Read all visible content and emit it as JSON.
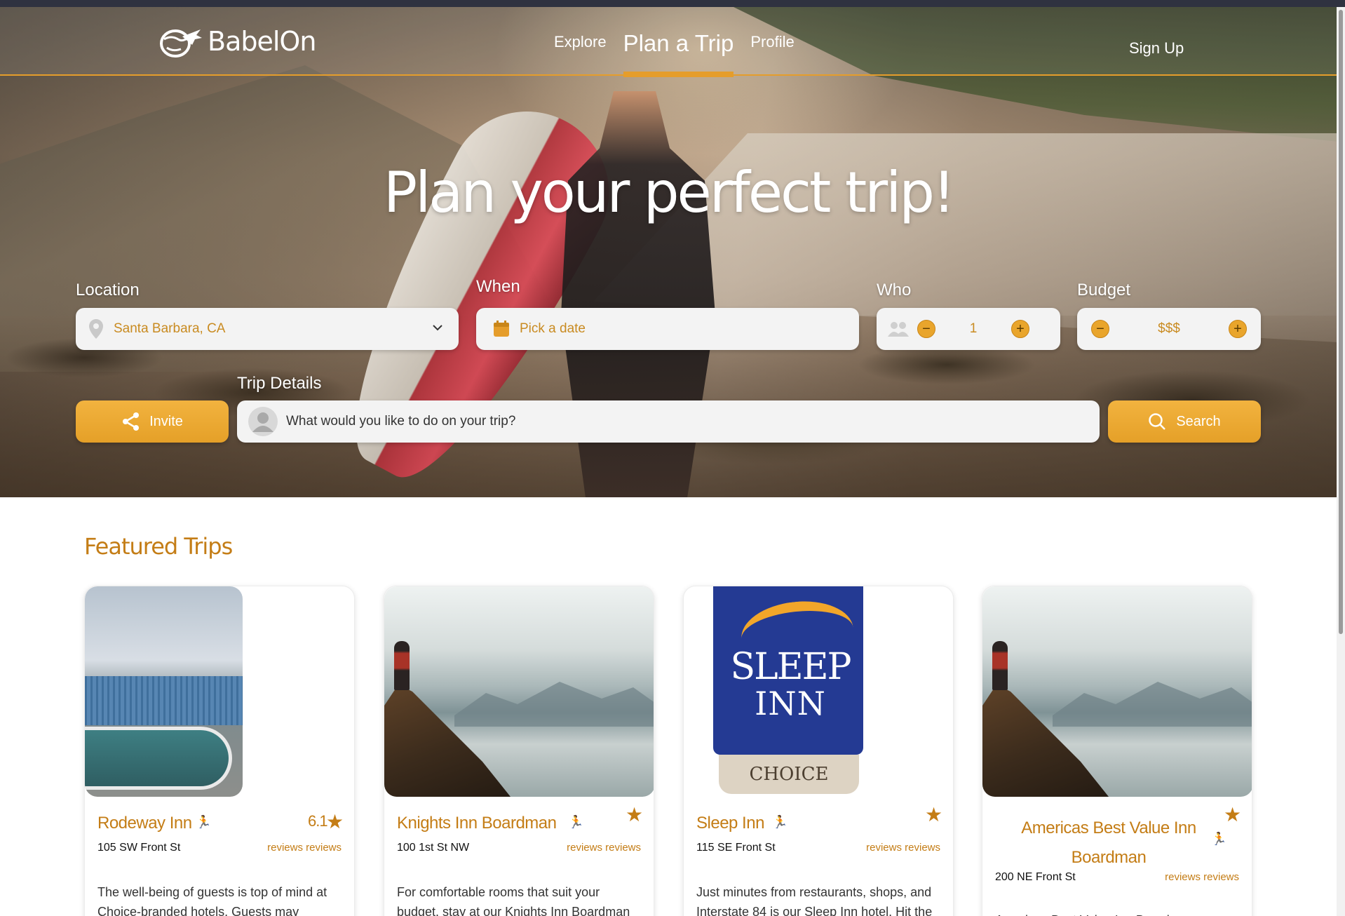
{
  "brand": {
    "name": "BabelOn",
    "accent": "#e59d2b",
    "title_color": "#c47d16"
  },
  "nav": {
    "links": [
      "Explore",
      "Plan a Trip",
      "Profile"
    ],
    "active": "Plan a Trip",
    "sign_up": "Sign Up"
  },
  "hero": {
    "title": "Plan your perfect trip!"
  },
  "search": {
    "location": {
      "label": "Location",
      "value": "Santa Barbara, CA",
      "icon": "map-pin-icon"
    },
    "when": {
      "label": "When",
      "placeholder": "Pick a date",
      "icon": "calendar-icon"
    },
    "who": {
      "label": "Who",
      "value": "1",
      "icon": "people-icon"
    },
    "budget": {
      "label": "Budget",
      "value": "$$$"
    },
    "trip_details": {
      "label": "Trip Details",
      "placeholder": "What would you like to do on your trip?"
    },
    "invite_label": "Invite",
    "search_label": "Search"
  },
  "featured": {
    "title": "Featured Trips",
    "cards": [
      {
        "name": "Rodeway Inn",
        "address": "105 SW Front St",
        "rating": "6.1",
        "reviews": "reviews reviews",
        "description": "The well-being of guests is top of mind at Choice-branded hotels. Guests may"
      },
      {
        "name": "Knights Inn Boardman",
        "address": "100 1st St NW",
        "rating": "",
        "reviews": "reviews reviews",
        "description": "For comfortable rooms that suit your budget, stay at our Knights Inn Boardman"
      },
      {
        "name": "Sleep Inn",
        "address": "115 SE Front St",
        "rating": "",
        "reviews": "reviews reviews",
        "description": "Just minutes from restaurants, shops, and Interstate 84 is our Sleep Inn hotel. Hit the"
      },
      {
        "name": "Americas Best Value Inn Boardman",
        "address": "200 NE Front St",
        "rating": "",
        "reviews": "reviews reviews",
        "description": "Americas Best Value Inn Boardman"
      }
    ],
    "sleep_inn_logo": {
      "word1": "SLEEP",
      "word2": "INN",
      "brand": "CHOICE"
    }
  }
}
